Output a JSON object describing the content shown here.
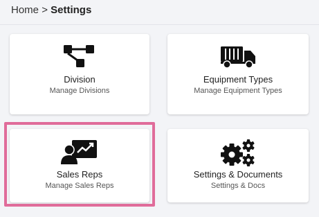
{
  "breadcrumb": {
    "home": "Home",
    "separator": ">",
    "current": "Settings"
  },
  "cards": [
    {
      "title": "Division",
      "subtitle": "Manage Divisions",
      "icon": "hierarchy-icon"
    },
    {
      "title": "Equipment Types",
      "subtitle": "Manage Equipment Types",
      "icon": "truck-icon"
    },
    {
      "title": "Sales Reps",
      "subtitle": "Manage Sales Reps",
      "icon": "presenter-chart-icon"
    },
    {
      "title": "Settings & Documents",
      "subtitle": "Settings & Docs",
      "icon": "gears-icon"
    }
  ],
  "colors": {
    "highlight": "#e06c9a",
    "icon": "#111111"
  }
}
